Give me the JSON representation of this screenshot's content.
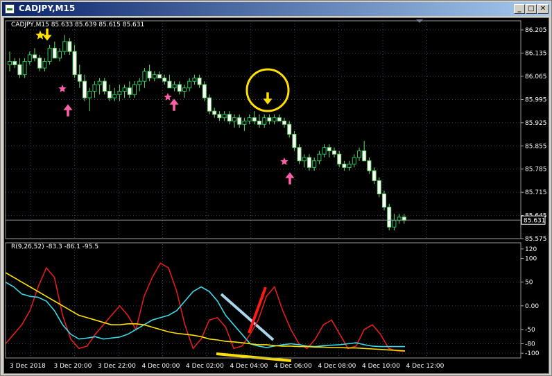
{
  "window": {
    "title": "CADJPY,M15",
    "minimize_glyph": "_",
    "restore_glyph": "□",
    "close_glyph": "✕"
  },
  "main_chart": {
    "header": "CADJPY,M15  85.633 85.639 85.615 85.631",
    "current_price_label": "85.631",
    "price_ticks": [
      "86.205",
      "86.135",
      "86.065",
      "85.995",
      "85.925",
      "85.855",
      "85.785",
      "85.715",
      "85.645",
      "85.575"
    ]
  },
  "indicator": {
    "header": "R(9,26,52) -83.3 -86.1 -95.5",
    "ticks": [
      "120",
      "100",
      "50",
      "0.00",
      "-50",
      "-80",
      "-100"
    ]
  },
  "time_axis": [
    "3 Dec 2018",
    "3 Dec 20:00",
    "3 Dec 22:00",
    "4 Dec 00:00",
    "4 Dec 02:00",
    "4 Dec 04:00",
    "4 Dec 06:00",
    "4 Dec 08:00",
    "4 Dec 10:00",
    "4 Dec 12:00"
  ],
  "colors": {
    "background": "#000000",
    "candle": "#22c55e",
    "wick": "#66dd66",
    "grid": "#34495e",
    "red_line": "#e11d1d",
    "cyan_line": "#3ad8e8",
    "yellow_line": "#ffe000",
    "marker_yellow": "#ffe000",
    "marker_pink": "#ff5fa8",
    "trend_lightblue": "#a9d6ec",
    "trend_red": "#ff1a1a"
  },
  "chart_data": {
    "type": "candlestick",
    "symbol": "CADJPY",
    "timeframe": "M15",
    "ylim": [
      85.575,
      86.22
    ],
    "candles_ohlc": [
      [
        86.1,
        86.14,
        86.08,
        86.11
      ],
      [
        86.11,
        86.12,
        86.09,
        86.1
      ],
      [
        86.1,
        86.12,
        86.06,
        86.07
      ],
      [
        86.07,
        86.12,
        86.06,
        86.11
      ],
      [
        86.11,
        86.14,
        86.1,
        86.13
      ],
      [
        86.13,
        86.15,
        86.11,
        86.12
      ],
      [
        86.12,
        86.13,
        86.08,
        86.09
      ],
      [
        86.09,
        86.12,
        86.08,
        86.11
      ],
      [
        86.11,
        86.16,
        86.1,
        86.15
      ],
      [
        86.15,
        86.17,
        86.12,
        86.12
      ],
      [
        86.12,
        86.15,
        86.11,
        86.14
      ],
      [
        86.14,
        86.19,
        86.13,
        86.17
      ],
      [
        86.17,
        86.18,
        86.13,
        86.14
      ],
      [
        86.14,
        86.16,
        86.06,
        86.07
      ],
      [
        86.07,
        86.1,
        86.03,
        86.05
      ],
      [
        86.05,
        86.07,
        85.99,
        86.0
      ],
      [
        86.0,
        86.03,
        85.96,
        86.02
      ],
      [
        86.02,
        86.05,
        86.0,
        86.04
      ],
      [
        86.04,
        86.06,
        86.01,
        86.05
      ],
      [
        86.05,
        86.06,
        86.01,
        86.02
      ],
      [
        86.02,
        86.04,
        85.99,
        86.0
      ],
      [
        86.0,
        86.03,
        85.99,
        86.01
      ],
      [
        86.01,
        86.04,
        85.99,
        86.02
      ],
      [
        86.02,
        86.04,
        86.0,
        86.03
      ],
      [
        86.03,
        86.05,
        86.0,
        86.01
      ],
      [
        86.01,
        86.05,
        86.0,
        86.04
      ],
      [
        86.04,
        86.06,
        86.02,
        86.05
      ],
      [
        86.05,
        86.09,
        86.03,
        86.08
      ],
      [
        86.08,
        86.1,
        86.05,
        86.06
      ],
      [
        86.06,
        86.08,
        86.05,
        86.07
      ],
      [
        86.07,
        86.08,
        86.06,
        86.06
      ],
      [
        86.06,
        86.07,
        86.04,
        86.05
      ],
      [
        86.05,
        86.07,
        86.03,
        86.03
      ],
      [
        86.03,
        86.05,
        86.02,
        86.04
      ],
      [
        86.04,
        86.05,
        86.01,
        86.02
      ],
      [
        86.02,
        86.04,
        86.0,
        86.03
      ],
      [
        86.03,
        86.06,
        86.02,
        86.05
      ],
      [
        86.05,
        86.07,
        86.04,
        86.06
      ],
      [
        86.06,
        86.07,
        86.03,
        86.04
      ],
      [
        86.04,
        86.05,
        85.99,
        86.0
      ],
      [
        86.0,
        86.01,
        85.95,
        85.96
      ],
      [
        85.96,
        85.97,
        85.94,
        85.95
      ],
      [
        85.95,
        85.96,
        85.93,
        85.94
      ],
      [
        85.94,
        85.96,
        85.93,
        85.95
      ],
      [
        85.95,
        85.96,
        85.92,
        85.93
      ],
      [
        85.93,
        85.95,
        85.91,
        85.94
      ],
      [
        85.94,
        85.95,
        85.91,
        85.92
      ],
      [
        85.92,
        85.94,
        85.9,
        85.93
      ],
      [
        85.93,
        85.95,
        85.92,
        85.94
      ],
      [
        85.94,
        85.96,
        85.92,
        85.93
      ],
      [
        85.93,
        85.95,
        85.91,
        85.92
      ],
      [
        85.92,
        85.95,
        85.91,
        85.94
      ],
      [
        85.94,
        85.95,
        85.92,
        85.93
      ],
      [
        85.93,
        85.95,
        85.92,
        85.94
      ],
      [
        85.94,
        85.95,
        85.93,
        85.93
      ],
      [
        85.93,
        85.94,
        85.91,
        85.92
      ],
      [
        85.92,
        85.93,
        85.88,
        85.89
      ],
      [
        85.89,
        85.9,
        85.84,
        85.85
      ],
      [
        85.85,
        85.86,
        85.8,
        85.81
      ],
      [
        85.81,
        85.83,
        85.79,
        85.82
      ],
      [
        85.82,
        85.83,
        85.78,
        85.79
      ],
      [
        85.79,
        85.82,
        85.78,
        85.81
      ],
      [
        85.81,
        85.84,
        85.8,
        85.83
      ],
      [
        85.83,
        85.86,
        85.82,
        85.85
      ],
      [
        85.85,
        85.86,
        85.82,
        85.84
      ],
      [
        85.84,
        85.85,
        85.82,
        85.83
      ],
      [
        85.83,
        85.84,
        85.79,
        85.8
      ],
      [
        85.8,
        85.81,
        85.78,
        85.79
      ],
      [
        85.79,
        85.81,
        85.78,
        85.8
      ],
      [
        85.8,
        85.83,
        85.79,
        85.82
      ],
      [
        85.82,
        85.85,
        85.81,
        85.84
      ],
      [
        85.84,
        85.87,
        85.83,
        85.81
      ],
      [
        85.81,
        85.82,
        85.77,
        85.78
      ],
      [
        85.78,
        85.79,
        85.74,
        85.75
      ],
      [
        85.75,
        85.76,
        85.7,
        85.71
      ],
      [
        85.71,
        85.72,
        85.66,
        85.67
      ],
      [
        85.67,
        85.68,
        85.6,
        85.61
      ],
      [
        85.61,
        85.65,
        85.6,
        85.63
      ],
      [
        85.63,
        85.65,
        85.62,
        85.64
      ],
      [
        85.64,
        85.65,
        85.62,
        85.63
      ]
    ],
    "indicator_series": [
      {
        "color": "red",
        "values": [
          -80,
          -60,
          -40,
          -10,
          40,
          80,
          60,
          -20,
          -70,
          -90,
          -85,
          -60,
          -40,
          -20,
          0,
          -20,
          -50,
          20,
          60,
          90,
          80,
          30,
          -40,
          -90,
          -70,
          -30,
          -25,
          -45,
          -90,
          -85,
          -60,
          -30,
          20,
          40,
          -10,
          -50,
          -80,
          -90,
          -70,
          -40,
          -30,
          -60,
          -90,
          -85,
          -50,
          -40,
          -60,
          -90,
          -95,
          -96
        ]
      },
      {
        "color": "cyan",
        "values": [
          50,
          40,
          25,
          20,
          18,
          10,
          -10,
          -40,
          -60,
          -70,
          -68,
          -65,
          -70,
          -68,
          -66,
          -60,
          -50,
          -40,
          -30,
          -25,
          -20,
          -10,
          10,
          30,
          40,
          30,
          10,
          -20,
          -40,
          -60,
          -80,
          -85,
          -88,
          -85,
          -82,
          -80,
          -82,
          -85,
          -86,
          -84,
          -83,
          -82,
          -80,
          -78,
          -82,
          -85,
          -86,
          -86,
          -86,
          -86
        ]
      },
      {
        "color": "yellow",
        "values": [
          70,
          60,
          50,
          40,
          30,
          20,
          10,
          0,
          -10,
          -20,
          -25,
          -30,
          -35,
          -40,
          -40,
          -38,
          -38,
          -40,
          -45,
          -50,
          -55,
          -58,
          -60,
          -62,
          -65,
          -70,
          -72,
          -75,
          -76,
          -78,
          -80,
          -82,
          -82,
          -84,
          -85,
          -85,
          -86,
          -86,
          -87,
          -87,
          -88,
          -88,
          -89,
          -89,
          -90,
          -91,
          -92,
          -93,
          -94,
          -95
        ]
      }
    ],
    "indicator_ylim": [
      -110,
      130
    ]
  }
}
